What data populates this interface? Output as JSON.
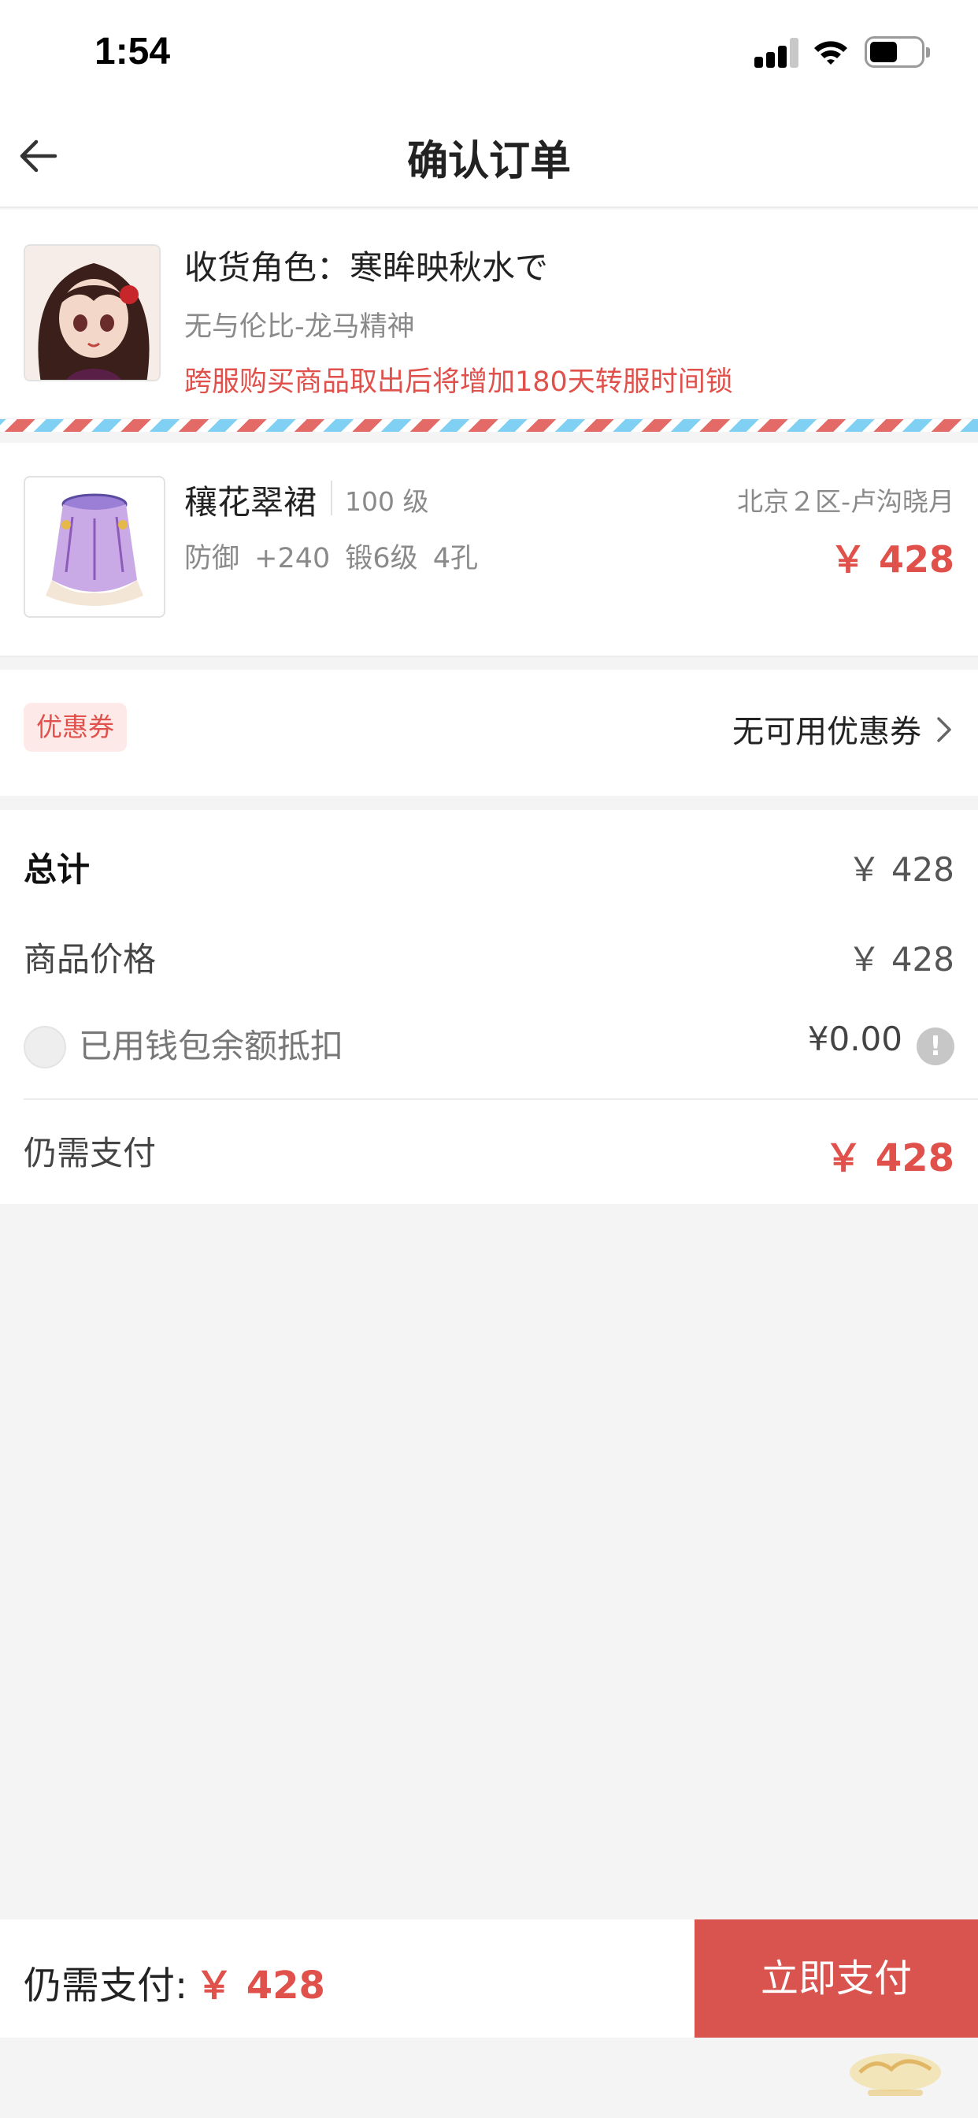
{
  "status_bar": {
    "time": "1:54"
  },
  "nav": {
    "title": "确认订单"
  },
  "receiver": {
    "name": "收货角色：寒眸映秋水で",
    "server": "无与伦比-龙马精神",
    "warning": "跨服购买商品取出后将增加180天转服时间锁"
  },
  "product": {
    "name": "穰花翠裙",
    "level": "100 级",
    "server": "北京２区-卢沟晓月",
    "attributes": "防御 +240  锻6级  4孔",
    "price": "￥ 428"
  },
  "coupon": {
    "tag": "优惠券",
    "value": "无可用优惠券"
  },
  "summary": {
    "total_label": "总计",
    "total_value": "￥ 428",
    "goods_label": "商品价格",
    "goods_value": "￥ 428",
    "wallet_label": "已用钱包余额抵扣",
    "wallet_value": "¥0.00",
    "due_label": "仍需支付",
    "due_value": "￥ 428"
  },
  "bottom_bar": {
    "label": "仍需支付:",
    "price": "￥ 428",
    "pay_button": "立即支付"
  },
  "icons": {
    "back": "arrow-left-icon",
    "chevron": "chevron-right-icon",
    "info": "exclamation-icon"
  },
  "colors": {
    "accent": "#e0514c",
    "pay_button": "#d9534f",
    "coupon_bg": "#fde9e8"
  }
}
